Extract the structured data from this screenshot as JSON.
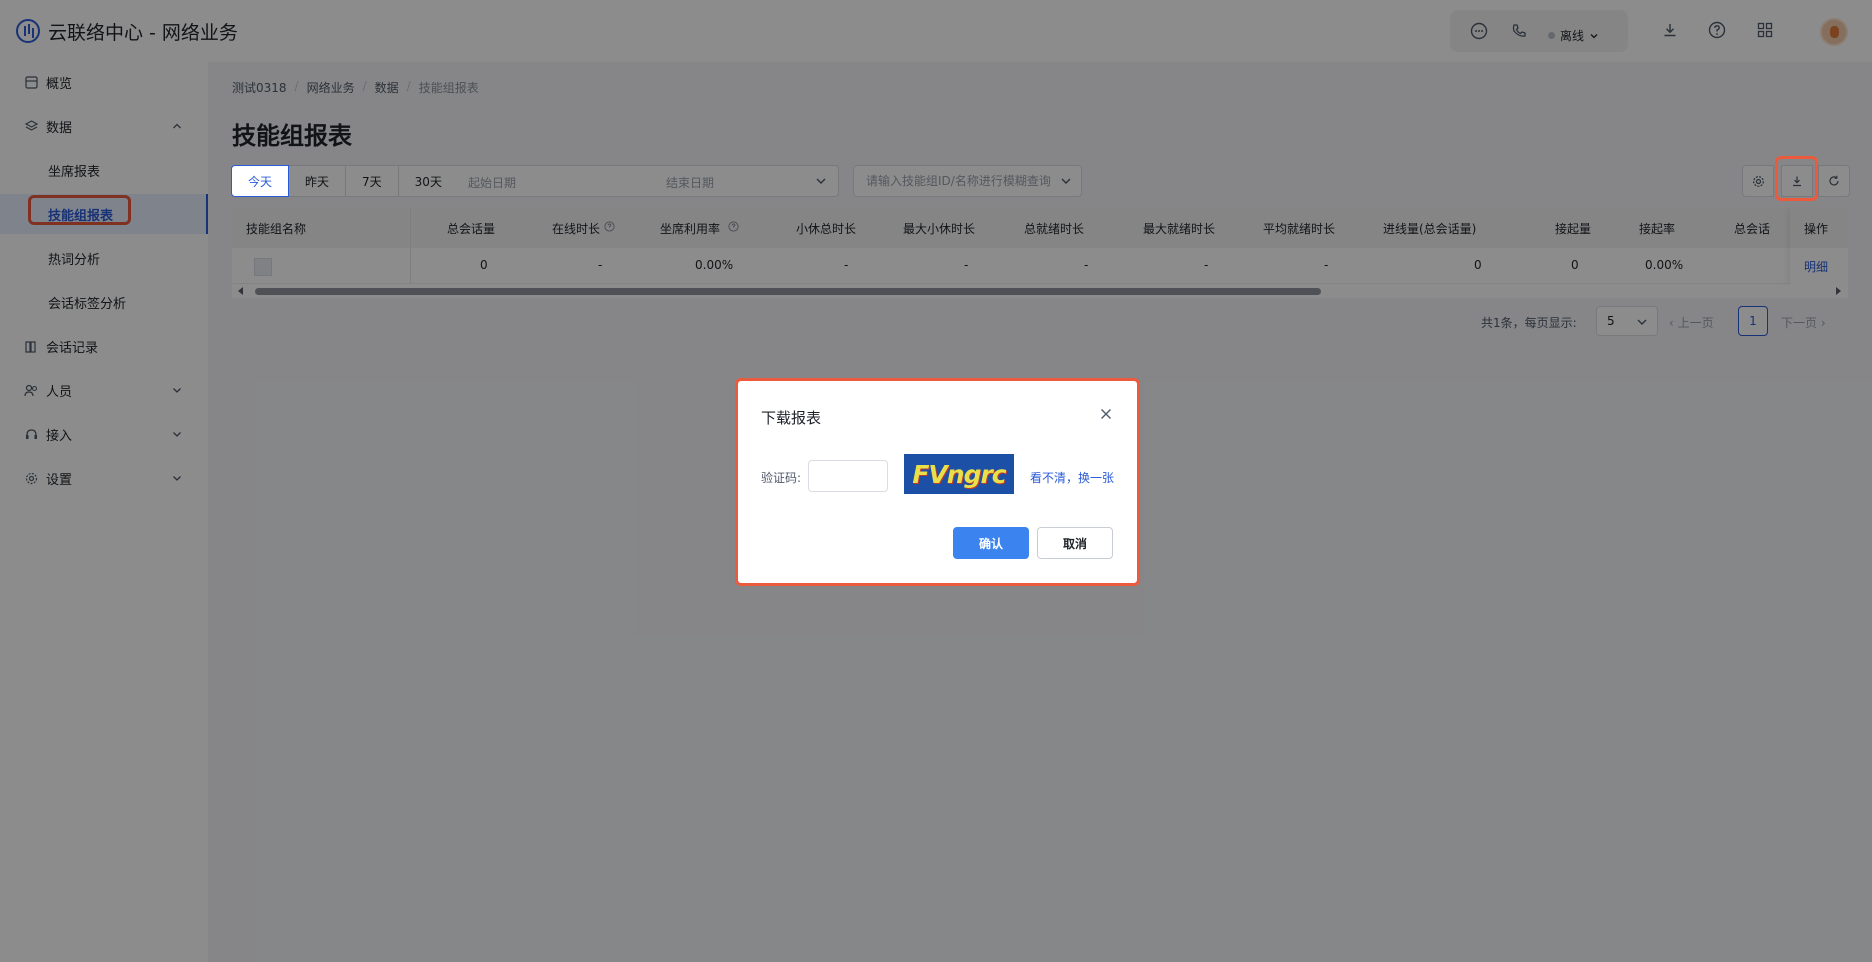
{
  "header": {
    "app_title": "云联络中心 - 网络业务",
    "status_text": "离线"
  },
  "sidebar": {
    "items": [
      {
        "label": "概览",
        "icon": "overview-icon"
      },
      {
        "label": "数据",
        "icon": "data-icon",
        "expanded": true
      },
      {
        "label": "会话记录",
        "icon": "session-record-icon"
      },
      {
        "label": "人员",
        "icon": "people-icon"
      },
      {
        "label": "接入",
        "icon": "access-icon"
      },
      {
        "label": "设置",
        "icon": "settings-icon"
      }
    ],
    "sub_items": [
      {
        "label": "坐席报表"
      },
      {
        "label": "技能组报表",
        "active": true
      },
      {
        "label": "热词分析"
      },
      {
        "label": "会话标签分析"
      }
    ]
  },
  "breadcrumb": [
    "测试0318",
    "网络业务",
    "数据",
    "技能组报表"
  ],
  "page_title": "技能组报表",
  "filters": {
    "ranges": [
      "今天",
      "昨天",
      "7天",
      "30天"
    ],
    "active_range": "今天",
    "start_date_placeholder": "起始日期",
    "end_date_placeholder": "结束日期",
    "search_placeholder": "请输入技能组ID/名称进行模糊查询"
  },
  "table": {
    "columns": [
      "技能组名称",
      "总会话量",
      "在线时长",
      "坐席利用率",
      "小休总时长",
      "最大小休时长",
      "总就绪时长",
      "最大就绪时长",
      "平均就绪时长",
      "进线量(总会话量)",
      "接起量",
      "接起率",
      "总会话",
      "操作"
    ],
    "rows": [
      {
        "name": "",
        "values": [
          "0",
          "-",
          "0.00%",
          "-",
          "-",
          "-",
          "-",
          "-",
          "0",
          "0",
          "0.00%",
          ""
        ],
        "action": "明细"
      }
    ]
  },
  "pagination": {
    "total_text": "共1条，每页显示:",
    "page_size": "5",
    "prev": "上一页",
    "current": "1",
    "next": "下一页"
  },
  "modal": {
    "title": "下载报表",
    "captcha_label": "验证码:",
    "captcha_value": "",
    "captcha_text": "FVngrc",
    "refresh_text": "看不清，换一张",
    "confirm": "确认",
    "cancel": "取消"
  },
  "colors": {
    "accent": "#2a5bd7",
    "highlight": "#ec5a3d",
    "confirm_button": "#3b84f0"
  }
}
